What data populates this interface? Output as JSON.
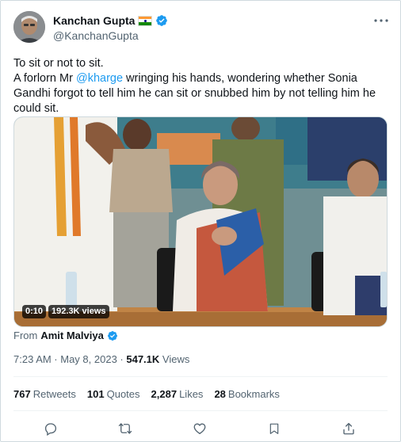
{
  "author": {
    "name": "Kanchan Gupta",
    "handle": "@KanchanGupta",
    "flag_icon": "india-flag-icon",
    "verified_icon": "verified-badge-icon"
  },
  "more_icon": "more-options-icon",
  "tweet": {
    "line1": "To sit or not to sit.",
    "line2_prefix": "A forlorn Mr ",
    "mention": "@kharge",
    "line2_suffix": " wringing his hands, wondering whether Sonia Gandhi forgot to tell him he can sit or snubbed him by not telling him he could sit."
  },
  "media": {
    "duration": "0:10",
    "views": "192.3K views"
  },
  "source": {
    "prefix": "From",
    "name": "Amit Malviya"
  },
  "meta": {
    "time": "7:23 AM · May 8, 2023 · ",
    "views_count": "547.1K",
    "views_label": " Views"
  },
  "stats": {
    "retweets_count": "767",
    "retweets_label": "Retweets",
    "quotes_count": "101",
    "quotes_label": "Quotes",
    "likes_count": "2,287",
    "likes_label": "Likes",
    "bookmarks_count": "28",
    "bookmarks_label": "Bookmarks"
  },
  "actions": [
    "reply-icon",
    "retweet-icon",
    "like-icon",
    "bookmark-icon",
    "share-icon"
  ],
  "colors": {
    "accent": "#1d9bf0",
    "text": "#0f1419",
    "secondary": "#536471",
    "border": "#cfd9de"
  }
}
